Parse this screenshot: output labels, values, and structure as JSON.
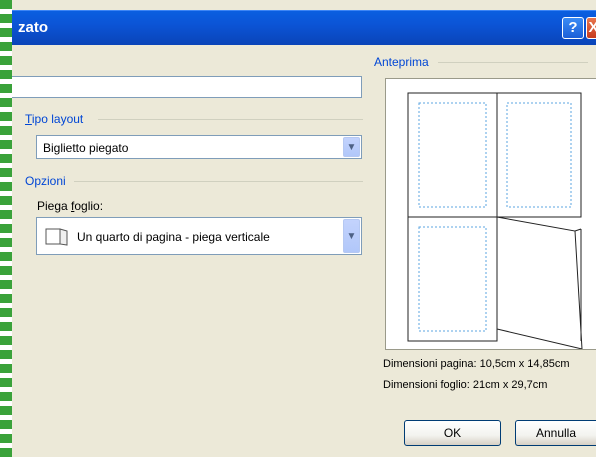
{
  "dialog": {
    "title": "zato",
    "help_label": "?",
    "close_label": "X"
  },
  "layout_group": {
    "label": "Tipo layout",
    "selected": "Biglietto piegato"
  },
  "options_group": {
    "label": "Opzioni",
    "fold_label": "Piega foglio:",
    "fold_selected": "Un quarto di pagina - piega verticale"
  },
  "preview": {
    "label": "Anteprima",
    "page_size": "Dimensioni pagina: 10,5cm x 14,85cm",
    "sheet_size": "Dimensioni foglio: 21cm x 29,7cm"
  },
  "buttons": {
    "ok": "OK",
    "cancel": "Annulla"
  },
  "colors": {
    "title_bar": "#0b54d6",
    "group_label": "#0046d5",
    "dialog_bg": "#ece9d8",
    "page_outline": "#5ba4e0"
  }
}
